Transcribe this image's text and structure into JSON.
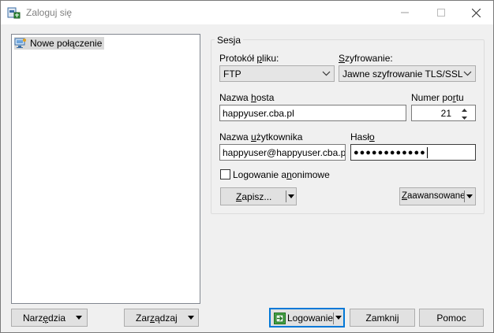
{
  "window": {
    "title": "Zaloguj się"
  },
  "tree": {
    "items": [
      {
        "label": "Nowe połączenie"
      }
    ]
  },
  "session": {
    "group_label": "Sesja",
    "protocol": {
      "label_pre": "Protokół ",
      "label_u": "p",
      "label_post": "liku:",
      "value": "FTP"
    },
    "encryption": {
      "label_u": "S",
      "label_post": "zyfrowanie:",
      "value": "Jawne szyfrowanie TLS/SSL"
    },
    "host": {
      "label_pre": "Nazwa ",
      "label_u": "h",
      "label_post": "osta",
      "value": "happyuser.cba.pl"
    },
    "port": {
      "label_pre": "Numer po",
      "label_u": "r",
      "label_post": "tu",
      "value": "21"
    },
    "username": {
      "label_pre": "Nazwa ",
      "label_u": "u",
      "label_post": "żytkownika",
      "value": "happyuser@happyuser.cba.pl"
    },
    "password": {
      "label_pre": "Hasł",
      "label_u": "o",
      "label_post": "",
      "value": "●●●●●●●●●●●●"
    },
    "anonymous": {
      "label_pre": "Logowanie a",
      "label_u": "n",
      "label_post": "onimowe",
      "checked": false
    },
    "save_button": {
      "label_pre": "",
      "label_u": "Z",
      "label_post": "apisz..."
    },
    "advanced_button": {
      "label_pre": "",
      "label_u": "Z",
      "label_post": "aawansowane"
    }
  },
  "footer": {
    "tools": {
      "label_pre": "Narz",
      "label_u": "ę",
      "label_post": "dzia"
    },
    "manage": {
      "label_pre": "Zar",
      "label_u": "z",
      "label_post": "ądzaj"
    },
    "login": {
      "label": "Logowanie"
    },
    "close": {
      "label": "Zamknij"
    },
    "help": {
      "label": "Pomoc"
    }
  }
}
